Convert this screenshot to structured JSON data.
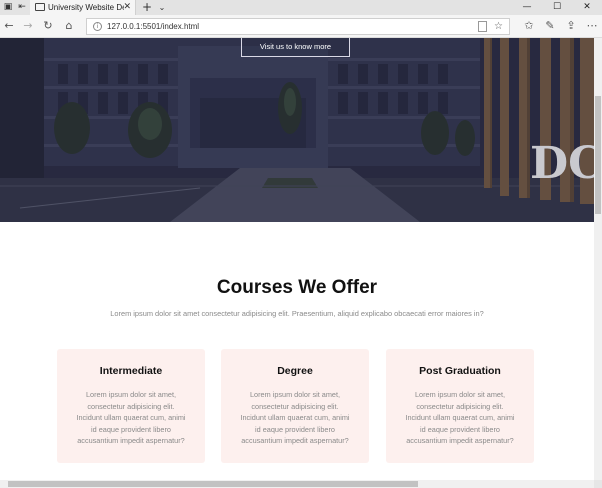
{
  "browser": {
    "tab_title": "University Website Desi",
    "address_url": "127.0.0.1:5501/index.html",
    "icons": [
      "tab-preview-icon",
      "set-aside-tabs-icon",
      "page-icon",
      "close-tab-icon",
      "new-tab-icon",
      "tab-menu-icon",
      "minimize-icon",
      "maximize-icon",
      "close-window-icon",
      "back-icon",
      "forward-icon",
      "refresh-icon",
      "home-icon",
      "site-info-icon",
      "reading-view-icon",
      "favorite-star-icon",
      "favorites-icon",
      "notes-icon",
      "share-icon",
      "more-icon"
    ]
  },
  "hero": {
    "button_label": "Visit us to know more",
    "sign_text": "DC"
  },
  "courses": {
    "title": "Courses We Offer",
    "subtitle": "Lorem ipsum dolor sit amet consectetur adipisicing elit. Praesentium, aliquid explicabo obcaecati error maiores in?",
    "cards": [
      {
        "title": "Intermediate",
        "lines": [
          "Lorem ipsum dolor sit amet,",
          "consectetur adipisicing elit.",
          "Incidunt ullam quaerat cum, animi",
          "id eaque provident libero",
          "accusantium impedit aspernatur?"
        ]
      },
      {
        "title": "Degree",
        "lines": [
          "Lorem ipsum dolor sit amet,",
          "consectetur adipisicing elit.",
          "Incidunt ullam quaerat cum, animi",
          "id eaque provident libero",
          "accusantium impedit aspernatur?"
        ]
      },
      {
        "title": "Post Graduation",
        "lines": [
          "Lorem ipsum dolor sit amet,",
          "consectetur adipisicing elit.",
          "Incidunt ullam quaerat cum, animi",
          "id eaque provident libero",
          "accusantium impedit aspernatur?"
        ]
      }
    ]
  }
}
